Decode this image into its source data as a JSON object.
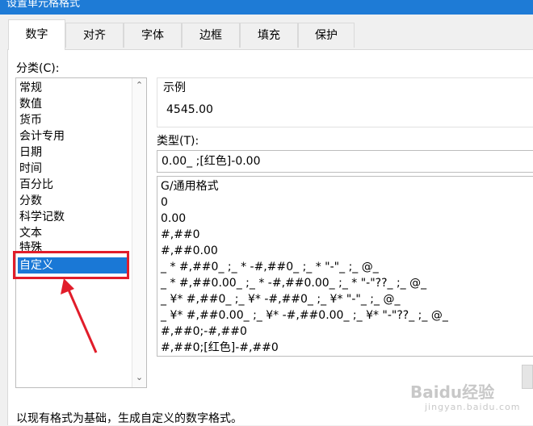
{
  "window": {
    "title": "设置单元格格式"
  },
  "tabs": [
    {
      "label": "数字",
      "active": true
    },
    {
      "label": "对齐",
      "active": false
    },
    {
      "label": "字体",
      "active": false
    },
    {
      "label": "边框",
      "active": false
    },
    {
      "label": "填充",
      "active": false
    },
    {
      "label": "保护",
      "active": false
    }
  ],
  "category": {
    "label": "分类(C):",
    "items": [
      "常规",
      "数值",
      "货币",
      "会计专用",
      "日期",
      "时间",
      "百分比",
      "分数",
      "科学记数",
      "文本",
      "特殊",
      "自定义"
    ],
    "selected": "自定义"
  },
  "sample": {
    "label": "示例",
    "value": "4545.00"
  },
  "type": {
    "label": "类型(T):",
    "value": "0.00_ ;[红色]-0.00",
    "formats": [
      "G/通用格式",
      "0",
      "0.00",
      "#,##0",
      "#,##0.00",
      "_ * #,##0_ ;_ * -#,##0_ ;_ * \"-\"_ ;_ @_",
      "_ * #,##0.00_ ;_ * -#,##0.00_ ;_ * \"-\"??_ ;_ @_",
      "_ ¥* #,##0_ ;_ ¥* -#,##0_ ;_ ¥* \"-\"_ ;_ @_",
      "_ ¥* #,##0.00_ ;_ ¥* -#,##0.00_ ;_ ¥* \"-\"??_ ;_ @_",
      "#,##0;-#,##0",
      "#,##0;[红色]-#,##0"
    ]
  },
  "description": "以现有格式为基础，生成自定义的数字格式。",
  "watermark": {
    "logo": "Baidu经验",
    "sub": "jingyan.baidu.com"
  },
  "colors": {
    "selection": "#1a78d6",
    "annotation": "#e11d2a",
    "titlebar": "#1e7bd6"
  }
}
